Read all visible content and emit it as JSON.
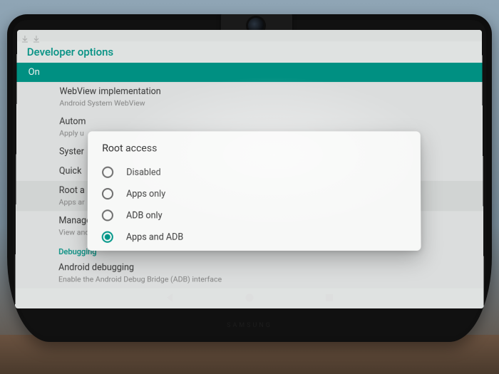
{
  "page_title": "Developer options",
  "subheader": "On",
  "settings": {
    "webview": {
      "title": "WebView implementation",
      "sub": "Android System WebView"
    },
    "autom": {
      "title": "Autom",
      "sub": "Apply u"
    },
    "system": {
      "title": "Syster"
    },
    "quick": {
      "title": "Quick"
    },
    "root": {
      "title": "Root a",
      "sub": "Apps ar"
    },
    "manage": {
      "title": "Manage root accesses",
      "sub": "View and control the root rules"
    },
    "android_dbg": {
      "title": "Android debugging",
      "sub": "Enable the Android Debug Bridge (ADB) interface"
    }
  },
  "section_debugging": "Debugging",
  "dialog": {
    "title": "Root access",
    "options": [
      {
        "label": "Disabled",
        "selected": false
      },
      {
        "label": "Apps only",
        "selected": false
      },
      {
        "label": "ADB only",
        "selected": false
      },
      {
        "label": "Apps and ADB",
        "selected": true
      }
    ]
  },
  "brand": "SAMSUNG"
}
